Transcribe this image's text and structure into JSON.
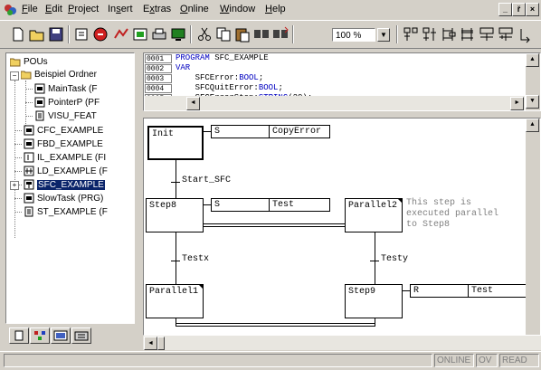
{
  "menubar": {
    "items": [
      {
        "label": "File",
        "underline": "F"
      },
      {
        "label": "Edit",
        "underline": "E"
      },
      {
        "label": "Project",
        "underline": "P"
      },
      {
        "label": "Insert",
        "underline": "s"
      },
      {
        "label": "Extras",
        "underline": "x"
      },
      {
        "label": "Online",
        "underline": "O"
      },
      {
        "label": "Window",
        "underline": "W"
      },
      {
        "label": "Help",
        "underline": "H"
      }
    ],
    "window_buttons": [
      "_",
      "ř",
      "×"
    ]
  },
  "toolbar": {
    "zoom": "100 %",
    "icons": [
      "new-icon",
      "open-icon",
      "save-icon",
      "build-icon",
      "stop-icon",
      "online-icon",
      "pou-icon",
      "print-icon",
      "monitor-icon",
      "cut-icon",
      "copy-icon",
      "paste-icon",
      "find-icon",
      "find-next-icon",
      "step-icon",
      "transition-icon",
      "branch-icon",
      "parallel-icon",
      "jump-icon",
      "return-icon"
    ]
  },
  "tree": {
    "root": "POUs",
    "folder": "Beispiel Ordner",
    "folder_children": [
      "MainTask (F",
      "PointerP (PF",
      "VISU_FEAT"
    ],
    "items": [
      "CFC_EXAMPLE",
      "FBD_EXAMPLE",
      "IL_EXAMPLE (FI",
      "LD_EXAMPLE (F",
      "SFC_EXAMPLE",
      "SlowTask (PRG)",
      "ST_EXAMPLE (F"
    ],
    "selected": "SFC_EXAMPLE"
  },
  "declaration": {
    "line_numbers": [
      "0001",
      "0002",
      "0003",
      "0004",
      "0005"
    ],
    "lines": [
      {
        "kw": "PROGRAM",
        "rest": " SFC_EXAMPLE"
      },
      {
        "kw": "VAR",
        "rest": ""
      },
      {
        "kw": "",
        "rest": "    SFCError:",
        "type": "BOOL",
        "tail": ";"
      },
      {
        "kw": "",
        "rest": "    SFCQuitError:",
        "type": "BOOL",
        "tail": ";"
      },
      {
        "kw": "",
        "rest": "    SFCErrorStep:",
        "type": "STRING",
        "tail": "(20);"
      }
    ]
  },
  "sfc": {
    "init_step": "Init",
    "init_action": {
      "qualifier": "S",
      "name": "CopyError"
    },
    "transition1": "Start_SFC",
    "step8": "Step8",
    "step8_action": {
      "qualifier": "S",
      "name": "Test"
    },
    "parallel2": "Parallel2",
    "comment": [
      "This step is",
      "executed parallel",
      "to Step8"
    ],
    "transition_x": "Testx",
    "transition_y": "Testy",
    "parallel1": "Parallel1",
    "step9": "Step9",
    "step9_action": {
      "qualifier": "R",
      "name": "Test"
    }
  },
  "status": {
    "panels": [
      "ONLINE",
      "OV",
      "READ"
    ]
  }
}
